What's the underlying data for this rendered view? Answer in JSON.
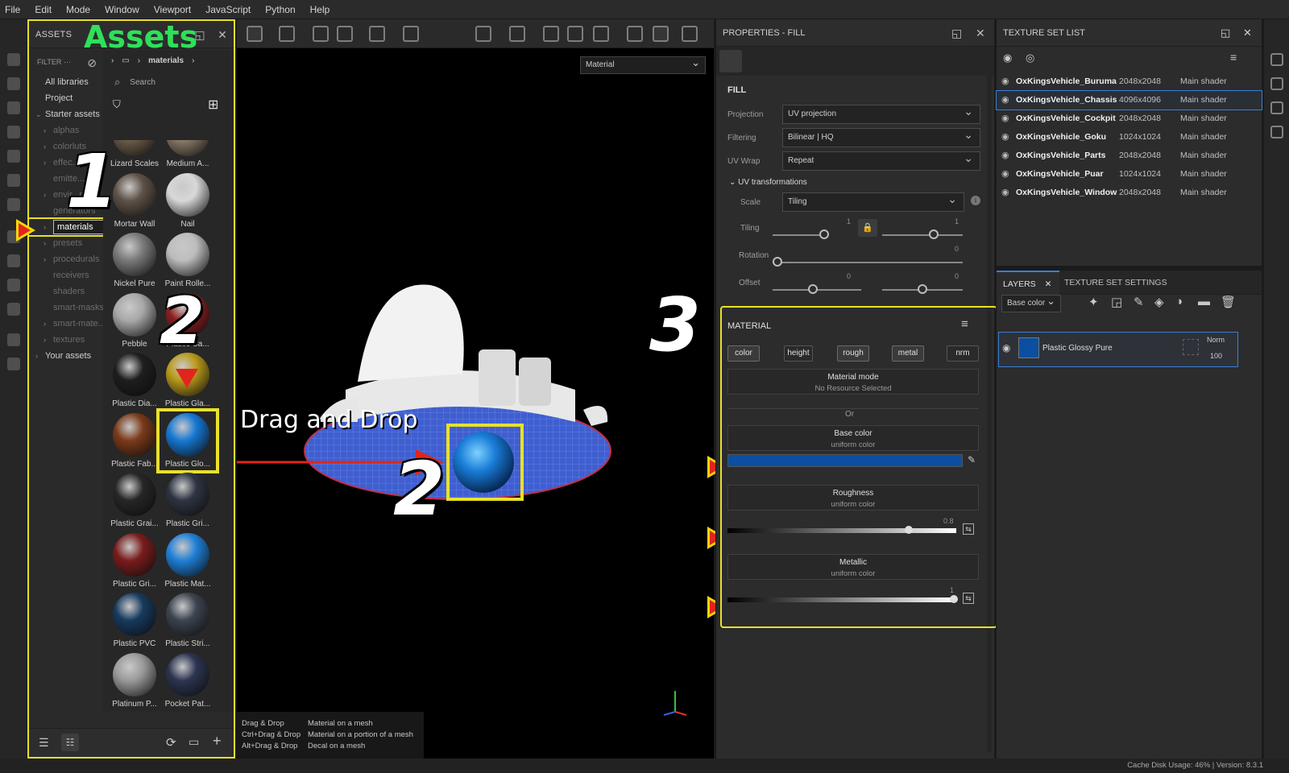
{
  "menu": [
    "File",
    "Edit",
    "Mode",
    "Window",
    "Viewport",
    "JavaScript",
    "Python",
    "Help"
  ],
  "assets": {
    "title": "ASSETS",
    "overlay_title": "Assets",
    "filter_label": "FILTER",
    "tree": [
      {
        "label": "All libraries",
        "indent": 0,
        "dim": false,
        "chev": false
      },
      {
        "label": "Project",
        "indent": 0,
        "dim": false,
        "chev": false
      },
      {
        "label": "Starter assets",
        "indent": 0,
        "dim": false,
        "chev": true,
        "open": true
      },
      {
        "label": "alphas",
        "indent": 1,
        "dim": true,
        "chev": true
      },
      {
        "label": "colorluts",
        "indent": 1,
        "dim": true,
        "chev": true
      },
      {
        "label": "effec...",
        "indent": 1,
        "dim": true,
        "chev": true
      },
      {
        "label": "emitte...",
        "indent": 1,
        "dim": true,
        "chev": false
      },
      {
        "label": "envir...nts",
        "indent": 1,
        "dim": true,
        "chev": true
      },
      {
        "label": "generators",
        "indent": 1,
        "dim": true,
        "chev": false
      },
      {
        "label": "materials",
        "indent": 1,
        "dim": false,
        "chev": true,
        "selected": true
      },
      {
        "label": "presets",
        "indent": 1,
        "dim": true,
        "chev": true
      },
      {
        "label": "procedurals",
        "indent": 1,
        "dim": true,
        "chev": true
      },
      {
        "label": "receivers",
        "indent": 1,
        "dim": true,
        "chev": false
      },
      {
        "label": "shaders",
        "indent": 1,
        "dim": true,
        "chev": false
      },
      {
        "label": "smart-masks",
        "indent": 1,
        "dim": true,
        "chev": false
      },
      {
        "label": "smart-mate...",
        "indent": 1,
        "dim": true,
        "chev": true
      },
      {
        "label": "textures",
        "indent": 1,
        "dim": true,
        "chev": true
      },
      {
        "label": "Your assets",
        "indent": 0,
        "dim": false,
        "chev": true
      }
    ],
    "breadcrumb": "materials",
    "search_placeholder": "Search",
    "tiles": [
      {
        "label": "Lizard Scales",
        "color": "#6b5b48"
      },
      {
        "label": "Medium A...",
        "color": "#8a7a66"
      },
      {
        "label": "Mortar Wall",
        "color": "#5e5248"
      },
      {
        "label": "Nail",
        "color": "#d8d8d8"
      },
      {
        "label": "Nickel Pure",
        "color": "#7a7a7a"
      },
      {
        "label": "Paint Rolle...",
        "color": "#bdbdbd"
      },
      {
        "label": "Pebble",
        "color": "#a8a8a8"
      },
      {
        "label": "Plastic Ca...",
        "color": "#8c1f1f"
      },
      {
        "label": "Plastic Dia...",
        "color": "#1e1e1e"
      },
      {
        "label": "Plastic Gla...",
        "color": "#b99a1a"
      },
      {
        "label": "Plastic Fab...",
        "color": "#7a3a1a"
      },
      {
        "label": "Plastic Glo...",
        "color": "#1677d2",
        "highlight": true
      },
      {
        "label": "Plastic Grai...",
        "color": "#262626"
      },
      {
        "label": "Plastic Gri...",
        "color": "#2e3442"
      },
      {
        "label": "Plastic Gri...",
        "color": "#7a1c1c"
      },
      {
        "label": "Plastic Mat...",
        "color": "#1f7fd6"
      },
      {
        "label": "Plastic PVC",
        "color": "#173a5e"
      },
      {
        "label": "Plastic Stri...",
        "color": "#3c4450"
      },
      {
        "label": "Platinum P...",
        "color": "#9a9a9a"
      },
      {
        "label": "Pocket Pat...",
        "color": "#2c3450"
      },
      {
        "label": "",
        "color": "#5a3a2a"
      },
      {
        "label": "",
        "color": "#6a2a22"
      }
    ]
  },
  "viewport": {
    "mode_select": "Material",
    "drag_label": "Drag and Drop",
    "hints": [
      {
        "k": "Drag & Drop",
        "v": "Material on a mesh"
      },
      {
        "k": "Ctrl+Drag & Drop",
        "v": "Material on a portion of a mesh"
      },
      {
        "k": "Alt+Drag & Drop",
        "v": "Decal on a mesh"
      }
    ]
  },
  "overlay_numbers": {
    "one": "1",
    "two": "2",
    "two_b": "2",
    "three": "3"
  },
  "properties": {
    "title": "PROPERTIES - FILL",
    "fill_title": "FILL",
    "projection_label": "Projection",
    "projection_value": "UV projection",
    "filtering_label": "Filtering",
    "filtering_value": "Bilinear | HQ",
    "uvwrap_label": "UV Wrap",
    "uvwrap_value": "Repeat",
    "uvt_title": "UV transformations",
    "scale_label": "Scale",
    "scale_value": "Tiling",
    "tiling_label": "Tiling",
    "tiling_a": "1",
    "tiling_b": "1",
    "rotation_label": "Rotation",
    "rotation_val": "0",
    "offset_label": "Offset",
    "offset_a": "0",
    "offset_b": "0",
    "material_title": "MATERIAL",
    "chips": [
      {
        "label": "color",
        "on": true
      },
      {
        "label": "height",
        "on": false
      },
      {
        "label": "rough",
        "on": true
      },
      {
        "label": "metal",
        "on": true
      },
      {
        "label": "nrm",
        "on": false
      }
    ],
    "material_mode_title": "Material mode",
    "material_mode_sub": "No Resource Selected",
    "or_label": "Or",
    "base_color_title": "Base color",
    "base_color_sub": "uniform color",
    "base_color_hex": "#0a4fa0",
    "roughness_title": "Roughness",
    "roughness_sub": "uniform color",
    "roughness_val": "0.8",
    "metallic_title": "Metallic",
    "metallic_sub": "uniform color",
    "metallic_val": "1"
  },
  "texture_set_list": {
    "title": "TEXTURE SET LIST",
    "rows": [
      {
        "name": "OxKingsVehicle_Buruma",
        "res": "2048x2048",
        "shader": "Main shader"
      },
      {
        "name": "OxKingsVehicle_Chassis",
        "res": "4096x4096",
        "shader": "Main shader",
        "selected": true
      },
      {
        "name": "OxKingsVehicle_Cockpit",
        "res": "2048x2048",
        "shader": "Main shader"
      },
      {
        "name": "OxKingsVehicle_Goku",
        "res": "1024x1024",
        "shader": "Main shader"
      },
      {
        "name": "OxKingsVehicle_Parts",
        "res": "2048x2048",
        "shader": "Main shader"
      },
      {
        "name": "OxKingsVehicle_Puar",
        "res": "1024x1024",
        "shader": "Main shader"
      },
      {
        "name": "OxKingsVehicle_Window",
        "res": "2048x2048",
        "shader": "Main shader"
      }
    ]
  },
  "layers": {
    "tab_layers": "LAYERS",
    "tab_settings": "TEXTURE SET SETTINGS",
    "channel": "Base color",
    "layer_name": "Plastic Glossy Pure",
    "blend": "Norm",
    "opacity": "100"
  },
  "status": "Cache Disk Usage:   46% | Version: 8.3.1"
}
